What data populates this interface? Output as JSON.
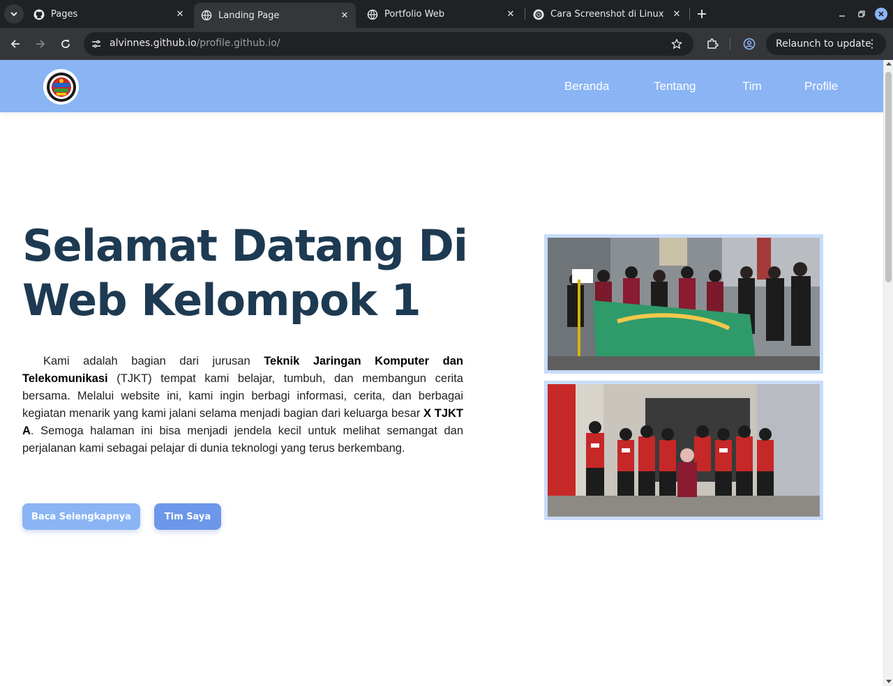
{
  "browser": {
    "tabs": [
      {
        "title": "Pages",
        "icon": "github-icon",
        "active": false
      },
      {
        "title": "Landing Page",
        "icon": "globe-icon",
        "active": true
      },
      {
        "title": "Portfolio Web",
        "icon": "globe-icon",
        "active": false
      },
      {
        "title": "Cara Screenshot di Linux",
        "icon": "chatgpt-icon",
        "active": false
      }
    ],
    "url_host": "alvinnes.github.io",
    "url_path": "/profile.github.io/",
    "relaunch_label": "Relaunch to update"
  },
  "nav": {
    "links": [
      "Beranda",
      "Tentang",
      "Tim",
      "Profile"
    ]
  },
  "hero": {
    "title_line1": "Selamat Datang Di",
    "title_line2": "Web Kelompok 1",
    "para_1": "Kami adalah bagian dari jurusan ",
    "para_bold_1": "Teknik Jaringan Komputer dan Telekomunikasi",
    "para_2": " (TJKT) tempat kami belajar, tumbuh, dan membangun cerita bersama. Melalui website ini, kami ingin berbagi informasi, cerita, dan berbagai kegiatan menarik yang kami jalani selama menjadi bagian dari keluarga besar ",
    "para_bold_2": "X TJKT A",
    "para_3": ". Semoga halaman ini bisa menjadi jendela kecil untuk melihat semangat dan perjalanan kami sebagai pelajar di dunia teknologi yang terus berkembang.",
    "btn_primary": "Baca Selengkapnya",
    "btn_secondary": "Tim Saya"
  },
  "colors": {
    "nav_bg": "#8ab4f4",
    "title": "#1d3a52",
    "btn_primary": "#8ab4f4",
    "btn_secondary": "#6d97e8",
    "photo_border": "#c9dcfb"
  }
}
